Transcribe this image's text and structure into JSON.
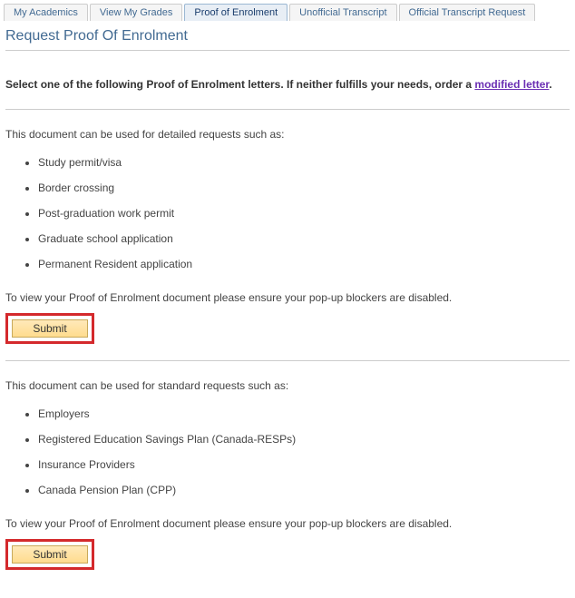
{
  "tabs": {
    "items": [
      {
        "label": "My Academics"
      },
      {
        "label": "View My Grades"
      },
      {
        "label": "Proof of Enrolment"
      },
      {
        "label": "Unofficial Transcript"
      },
      {
        "label": "Official Transcript Request"
      }
    ]
  },
  "page": {
    "title": "Request Proof Of Enrolment",
    "instruction_prefix": "Select one of the following Proof of Enrolment letters. If neither fulfills your needs, order a ",
    "modified_link_text": "modified letter",
    "instruction_suffix": "."
  },
  "section1": {
    "intro": "This document can be used for detailed requests such as:",
    "items": [
      "Study permit/visa",
      "Border crossing",
      "Post-graduation work permit",
      "Graduate school application",
      "Permanent Resident application"
    ],
    "popup_note": "To view your Proof of Enrolment document please ensure your pop-up blockers are disabled.",
    "submit_label": "Submit"
  },
  "section2": {
    "intro": "This document can be used for standard requests such as:",
    "items": [
      "Employers",
      "Registered Education Savings Plan (Canada-RESPs)",
      "Insurance Providers",
      "Canada Pension Plan (CPP)"
    ],
    "popup_note": "To view your Proof of Enrolment document please ensure your pop-up blockers are disabled.",
    "submit_label": "Submit"
  }
}
